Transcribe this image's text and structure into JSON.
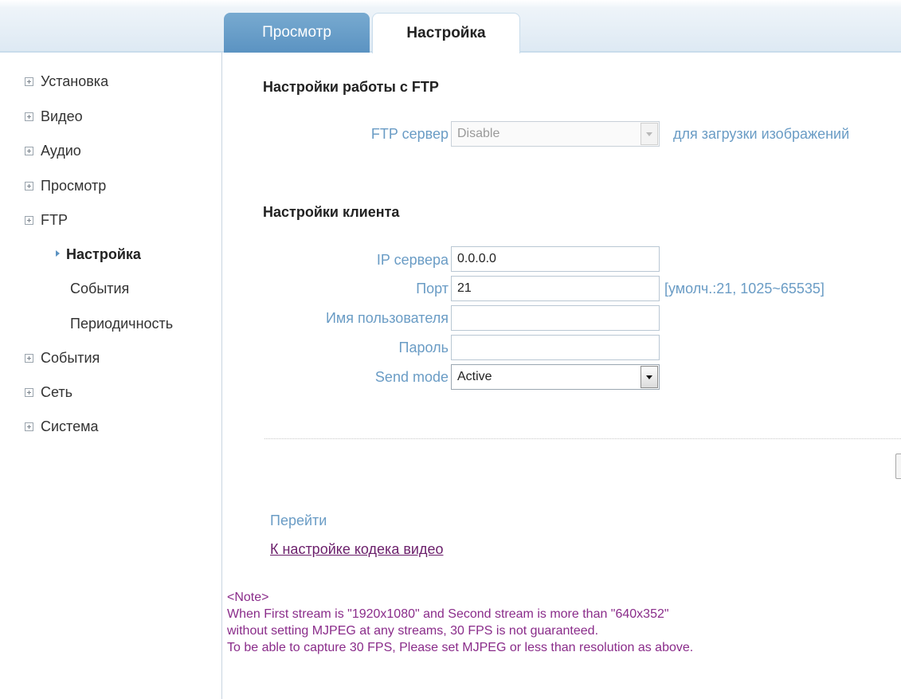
{
  "tabs": {
    "view": "Просмотр",
    "settings": "Настройка"
  },
  "sidebar": {
    "items": [
      {
        "label": "Установка"
      },
      {
        "label": "Видео"
      },
      {
        "label": "Аудио"
      },
      {
        "label": "Просмотр"
      },
      {
        "label": "FTP"
      }
    ],
    "ftp_sub": [
      {
        "label": "Настройка",
        "active": true
      },
      {
        "label": "События"
      },
      {
        "label": "Периодичность"
      }
    ],
    "items_after": [
      {
        "label": "События"
      },
      {
        "label": "Сеть"
      },
      {
        "label": "Система"
      }
    ]
  },
  "ftp_section": {
    "title": "Настройки работы с FTP",
    "server_label": "FTP сервер",
    "server_value": "Disable",
    "server_hint": "для загрузки изображений"
  },
  "client_section": {
    "title": "Настройки клиента",
    "ip_label": "IP сервера",
    "ip_value": "0.0.0.0",
    "port_label": "Порт",
    "port_value": "21",
    "port_hint": "[умолч.:21, 1025~65535]",
    "user_label": "Имя пользователя",
    "user_value": "",
    "password_label": "Пароль",
    "password_value": "",
    "mode_label": "Send mode",
    "mode_value": "Active"
  },
  "goto": {
    "label": "Перейти",
    "link": "К настройке кодека видео"
  },
  "note": {
    "lines": [
      "<Note>",
      "When First stream is \"1920x1080\" and Second stream is more than \"640x352\"",
      "without setting MJPEG at any streams, 30 FPS is not guaranteed.",
      "To be able to capture 30 FPS, Please set MJPEG or less than resolution as above."
    ]
  },
  "colors": {
    "accent": "#5b93c2",
    "label": "#6a9cc5",
    "link": "#6b1f6b",
    "note": "#8a2c8a"
  }
}
